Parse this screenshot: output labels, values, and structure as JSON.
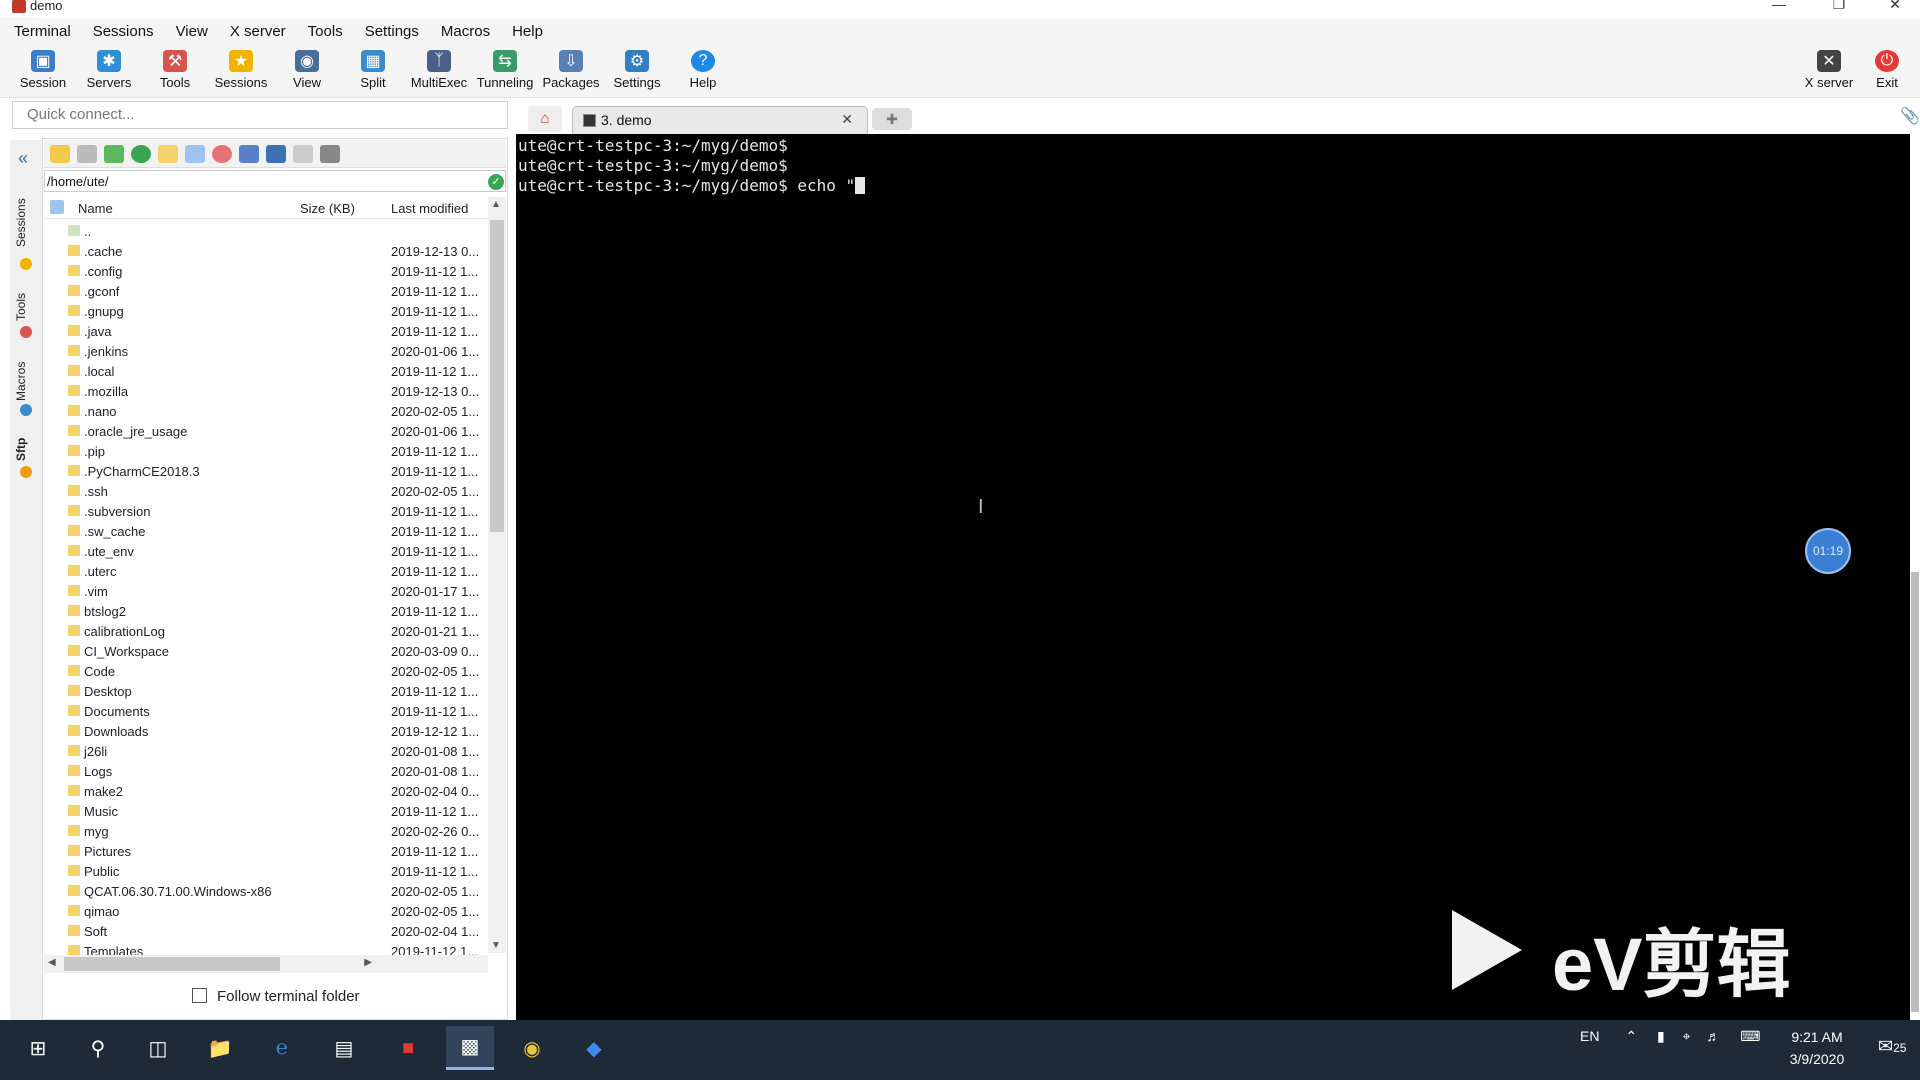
{
  "window": {
    "title": "demo"
  },
  "menu": [
    "Terminal",
    "Sessions",
    "View",
    "X server",
    "Tools",
    "Settings",
    "Macros",
    "Help"
  ],
  "toolbar": {
    "buttons": [
      "Session",
      "Servers",
      "Tools",
      "Sessions",
      "View",
      "Split",
      "MultiExec",
      "Tunneling",
      "Packages",
      "Settings",
      "Help"
    ],
    "xserver": "X server",
    "exit": "Exit"
  },
  "quick_connect": {
    "placeholder": "Quick connect..."
  },
  "tabs": {
    "active": "3. demo"
  },
  "sidebar": {
    "tabs": [
      "Sessions",
      "Tools",
      "Macros",
      "Sftp"
    ]
  },
  "sftp": {
    "path": "/home/ute/",
    "columns": {
      "name": "Name",
      "size": "Size (KB)",
      "modified": "Last modified"
    },
    "files": [
      {
        "name": "..",
        "modified": ""
      },
      {
        "name": ".cache",
        "modified": "2019-12-13 0..."
      },
      {
        "name": ".config",
        "modified": "2019-11-12 1..."
      },
      {
        "name": ".gconf",
        "modified": "2019-11-12 1..."
      },
      {
        "name": ".gnupg",
        "modified": "2019-11-12 1..."
      },
      {
        "name": ".java",
        "modified": "2019-11-12 1..."
      },
      {
        "name": ".jenkins",
        "modified": "2020-01-06 1..."
      },
      {
        "name": ".local",
        "modified": "2019-11-12 1..."
      },
      {
        "name": ".mozilla",
        "modified": "2019-12-13 0..."
      },
      {
        "name": ".nano",
        "modified": "2020-02-05 1..."
      },
      {
        "name": ".oracle_jre_usage",
        "modified": "2020-01-06 1..."
      },
      {
        "name": ".pip",
        "modified": "2019-11-12 1..."
      },
      {
        "name": ".PyCharmCE2018.3",
        "modified": "2019-11-12 1..."
      },
      {
        "name": ".ssh",
        "modified": "2020-02-05 1..."
      },
      {
        "name": ".subversion",
        "modified": "2019-11-12 1..."
      },
      {
        "name": ".sw_cache",
        "modified": "2019-11-12 1..."
      },
      {
        "name": ".ute_env",
        "modified": "2019-11-12 1..."
      },
      {
        "name": ".uterc",
        "modified": "2019-11-12 1..."
      },
      {
        "name": ".vim",
        "modified": "2020-01-17 1..."
      },
      {
        "name": "btslog2",
        "modified": "2019-11-12 1..."
      },
      {
        "name": "calibrationLog",
        "modified": "2020-01-21 1..."
      },
      {
        "name": "CI_Workspace",
        "modified": "2020-03-09 0..."
      },
      {
        "name": "Code",
        "modified": "2020-02-05 1..."
      },
      {
        "name": "Desktop",
        "modified": "2019-11-12 1..."
      },
      {
        "name": "Documents",
        "modified": "2019-11-12 1..."
      },
      {
        "name": "Downloads",
        "modified": "2019-12-12 1..."
      },
      {
        "name": "j26li",
        "modified": "2020-01-08 1..."
      },
      {
        "name": "Logs",
        "modified": "2020-01-08 1..."
      },
      {
        "name": "make2",
        "modified": "2020-02-04 0..."
      },
      {
        "name": "Music",
        "modified": "2019-11-12 1..."
      },
      {
        "name": "myg",
        "modified": "2020-02-26 0..."
      },
      {
        "name": "Pictures",
        "modified": "2019-11-12 1..."
      },
      {
        "name": "Public",
        "modified": "2019-11-12 1..."
      },
      {
        "name": "QCAT.06.30.71.00.Windows-x86",
        "modified": "2020-02-05 1..."
      },
      {
        "name": "qimao",
        "modified": "2020-02-05 1..."
      },
      {
        "name": "Soft",
        "modified": "2020-02-04 1..."
      },
      {
        "name": "Templates",
        "modified": "2019-11-12 1..."
      }
    ],
    "follow_label": "Follow terminal folder"
  },
  "terminal": {
    "lines": [
      "ute@crt-testpc-3:~/myg/demo$",
      "ute@crt-testpc-3:~/myg/demo$",
      "ute@crt-testpc-3:~/myg/demo$ echo \""
    ]
  },
  "overlay": {
    "timer": "01:19",
    "watermark": "eV剪辑"
  },
  "taskbar": {
    "lang": "EN",
    "time": "9:21 AM",
    "date": "3/9/2020",
    "notifications": "25"
  }
}
